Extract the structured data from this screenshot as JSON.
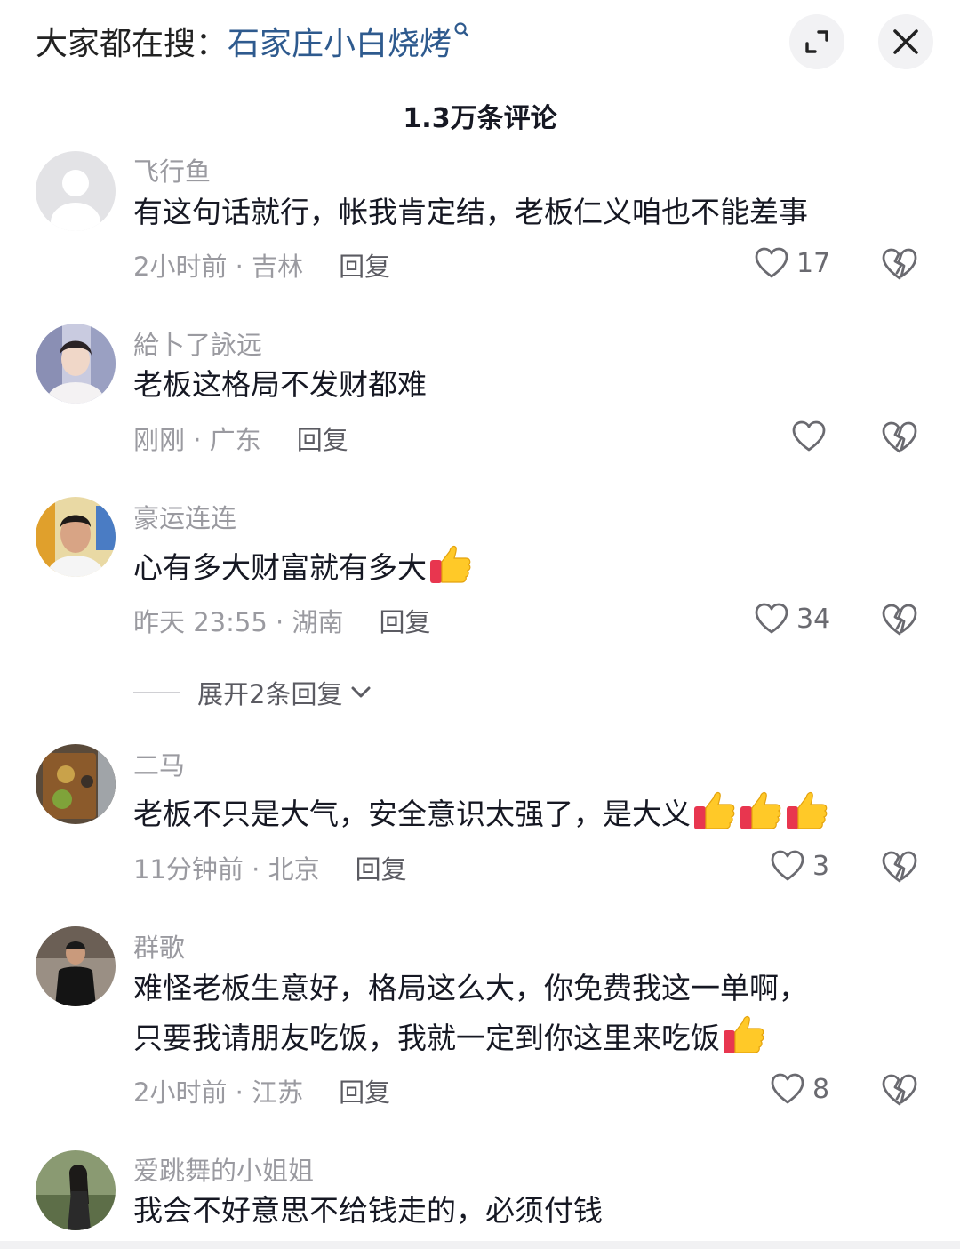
{
  "header": {
    "search_prefix": "大家都在搜：",
    "search_term": "石家庄小白烧烤",
    "comment_count": "1.3万条评论"
  },
  "comments": [
    {
      "username": "飞行鱼",
      "text": "有这句话就行，帐我肯定结，老板仁义咱也不能差事",
      "time": "2小时前",
      "location": "吉林",
      "reply_label": "回复",
      "likes": "17"
    },
    {
      "username": "給卜了詠远",
      "text": "老板这格局不发财都难",
      "time": "刚刚",
      "location": "广东",
      "reply_label": "回复",
      "likes": ""
    },
    {
      "username": "豪运连连",
      "text": "心有多大财富就有多大",
      "time": "昨天 23:55",
      "location": "湖南",
      "reply_label": "回复",
      "likes": "34"
    },
    {
      "username": "二马",
      "text": "老板不只是大气，安全意识太强了，是大义",
      "time": "11分钟前",
      "location": "北京",
      "reply_label": "回复",
      "likes": "3"
    },
    {
      "username": "群歌",
      "text_line1": "难怪老板生意好，格局这么大，你免费我这一单啊，",
      "text_line2": "只要我请朋友吃饭，我就一定到你这里来吃饭",
      "time": "2小时前",
      "location": "江苏",
      "reply_label": "回复",
      "likes": "8"
    },
    {
      "username": "爱跳舞的小姐姐",
      "text": "我会不好意思不给钱走的，必须付钱"
    }
  ],
  "expand_replies": "展开2条回复",
  "meta_separator": " · ",
  "icons": {
    "search": "search-icon",
    "expand": "expand-icon",
    "close": "close-icon",
    "like": "heart-outline-icon",
    "dislike": "broken-heart-icon",
    "emoji": "thumbs-up-emoji-icon",
    "chevron": "chevron-down-icon"
  },
  "colors": {
    "search_term": "#2e5a8e",
    "text": "#161823",
    "muted": "#9a9aa0"
  }
}
